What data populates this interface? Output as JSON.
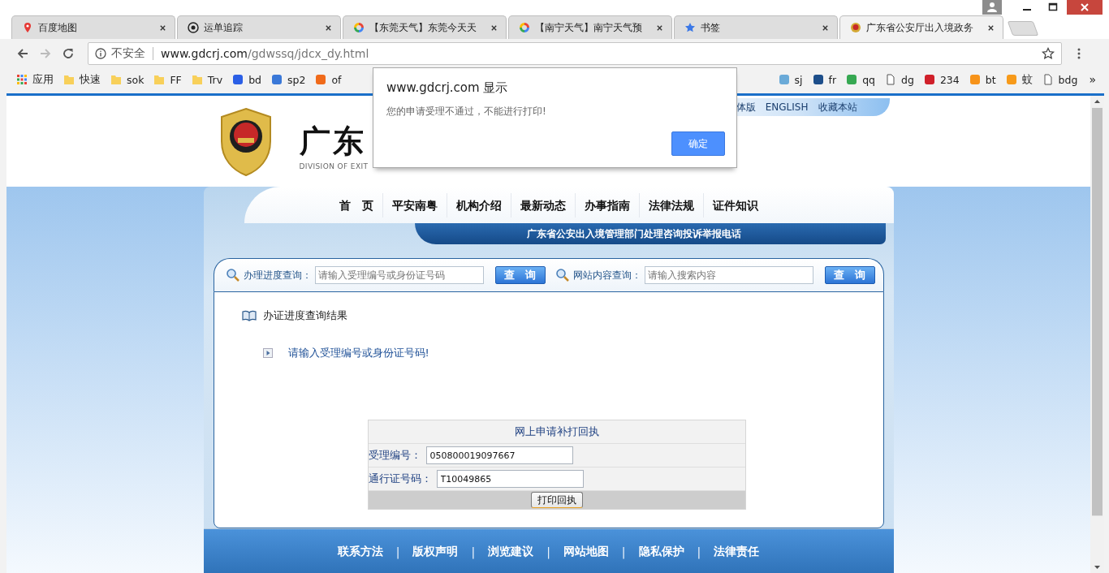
{
  "tabs": [
    {
      "label": "百度地图",
      "kind": "pin",
      "selected": false
    },
    {
      "label": "运单追踪",
      "kind": "sf",
      "selected": false
    },
    {
      "label": "【东莞天气】东莞今天天",
      "kind": "swirl",
      "selected": false
    },
    {
      "label": "【南宁天气】南宁天气预",
      "kind": "swirl",
      "selected": false
    },
    {
      "label": "书签",
      "kind": "star",
      "selected": false
    },
    {
      "label": "广东省公安厅出入境政务",
      "kind": "emblem",
      "selected": true
    }
  ],
  "toolbar": {
    "security": "不安全",
    "url_host": "www.gdcrj.com",
    "url_path": "/gdwssq/jdcx_dy.html"
  },
  "bookmarks_start": [
    {
      "label": "应用",
      "kind": "apps"
    },
    {
      "label": "快速",
      "kind": "folder"
    },
    {
      "label": "sok",
      "kind": "folder"
    },
    {
      "label": "FF",
      "kind": "folder"
    },
    {
      "label": "Trv",
      "kind": "folder"
    },
    {
      "label": "bd",
      "kind": "site",
      "color": "#2b5fe6"
    },
    {
      "label": "sp2",
      "kind": "site",
      "color": "#3a78d8"
    },
    {
      "label": "of",
      "kind": "site",
      "color": "#f06a1a"
    }
  ],
  "bookmarks_end": [
    {
      "label": "sj",
      "kind": "site",
      "color": "#6aaad8"
    },
    {
      "label": "fr",
      "kind": "site",
      "color": "#1d4e8a"
    },
    {
      "label": "qq",
      "kind": "site",
      "color": "#36a852"
    },
    {
      "label": "dg",
      "kind": "page"
    },
    {
      "label": "234",
      "kind": "site",
      "color": "#d0202a"
    },
    {
      "label": "bt",
      "kind": "site",
      "color": "#f7931a"
    },
    {
      "label": "蚊",
      "kind": "site",
      "color": "#f79a1a"
    },
    {
      "label": "bdg",
      "kind": "page"
    }
  ],
  "bookmarks_more": "»",
  "header": {
    "title": "广东",
    "subtitle": "DIVISION OF EXIT",
    "links": [
      "体版",
      "ENGLISH",
      "收藏本站"
    ]
  },
  "nav": [
    "首　页",
    "平安南粤",
    "机构介绍",
    "最新动态",
    "办事指南",
    "法律法规",
    "证件知识"
  ],
  "banner": "广东省公安出入境管理部门处理咨询投诉举报电话",
  "search": [
    {
      "label": "办理进度查询：",
      "placeholder": "请输入受理编号或身份证号码",
      "button": "查　询"
    },
    {
      "label": "网站内容查询：",
      "placeholder": "请输入搜索内容",
      "button": "查　询"
    }
  ],
  "result": {
    "title": "办证进度查询结果",
    "message": "请输入受理编号或身份证号码!"
  },
  "reprint_form": {
    "title": "网上申请补打回执",
    "fields": [
      {
        "label": "受理编号：",
        "value": "050800019097667"
      },
      {
        "label": "通行证号码：",
        "value": "T10049865"
      }
    ],
    "button": "打印回执"
  },
  "footer": [
    {
      "kind": "link",
      "label": "联系方法"
    },
    {
      "kind": "separator",
      "label": "|"
    },
    {
      "kind": "link",
      "label": "版权声明"
    },
    {
      "kind": "separator",
      "label": "|"
    },
    {
      "kind": "link",
      "label": "浏览建议"
    },
    {
      "kind": "separator",
      "label": "|"
    },
    {
      "kind": "link",
      "label": "网站地图"
    },
    {
      "kind": "separator",
      "label": "|"
    },
    {
      "kind": "link",
      "label": "隐私保护"
    },
    {
      "kind": "separator",
      "label": "|"
    },
    {
      "kind": "link",
      "label": "法律责任"
    }
  ],
  "dialog": {
    "title": "www.gdcrj.com 显示",
    "message": "您的申请受理不通过，不能进行打印!",
    "button": "确定"
  }
}
